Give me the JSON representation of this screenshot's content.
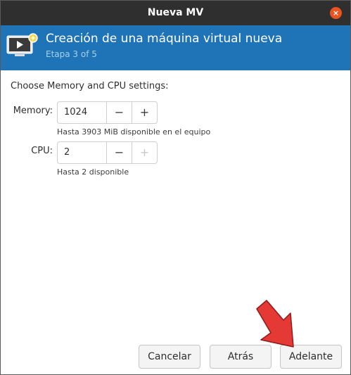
{
  "window": {
    "title": "Nueva MV",
    "close_glyph": "×"
  },
  "banner": {
    "title": "Creación de una máquina virtual nueva",
    "step": "Etapa 3 of 5",
    "icon": "vm-screen-icon"
  },
  "form": {
    "heading": "Choose Memory and CPU settings:",
    "memory": {
      "label": "Memory:",
      "value": "1024",
      "hint": "Hasta 3903 MiB disponible en el equipo"
    },
    "cpu": {
      "label": "CPU:",
      "value": "2",
      "hint": "Hasta 2 disponible",
      "increment_disabled": true
    }
  },
  "spin_glyphs": {
    "minus": "−",
    "plus": "+"
  },
  "buttons": {
    "cancel": "Cancelar",
    "back": "Atrás",
    "forward": "Adelante"
  },
  "colors": {
    "accent": "#1f73b7",
    "titlebar": "#2f2f2f",
    "close": "#e95420",
    "annotation_arrow": "#e53935"
  }
}
